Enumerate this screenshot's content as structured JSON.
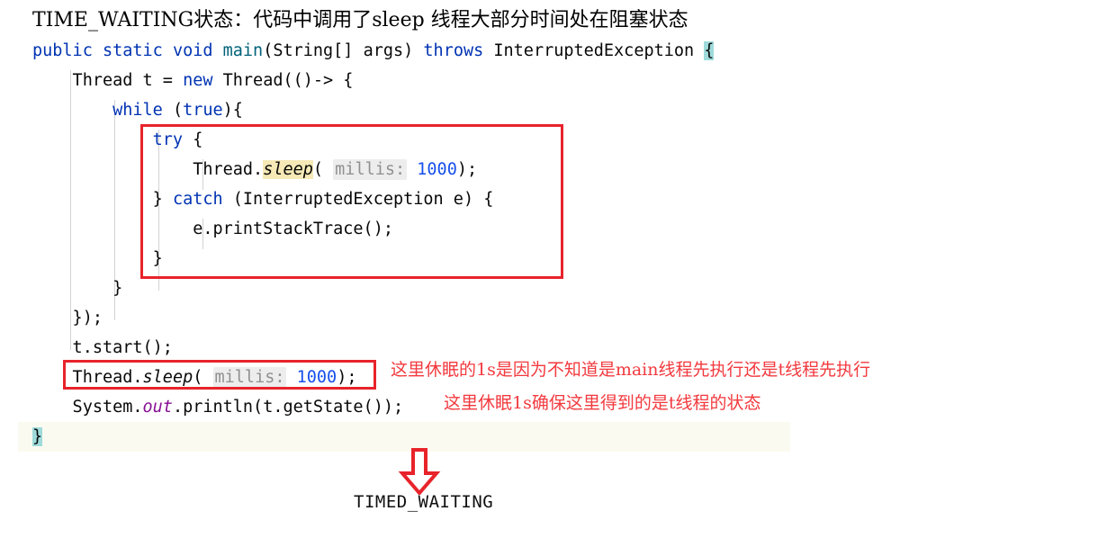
{
  "title": "TIME_WAITING状态：代码中调用了sleep 线程大部分时间处在阻塞状态",
  "editor": {
    "lines": [
      {
        "id": "line-1",
        "segments": [
          {
            "text": "public ",
            "style": "kw"
          },
          {
            "text": "static ",
            "style": "kw"
          },
          {
            "text": "void ",
            "style": "kw"
          },
          {
            "text": "main",
            "style": "meth"
          },
          {
            "text": "(String[] args) ",
            "style": "plain"
          },
          {
            "text": "throws ",
            "style": "kw"
          },
          {
            "text": "InterruptedException ",
            "style": "plain"
          },
          {
            "text": "{",
            "style": "brace-match"
          }
        ]
      },
      {
        "id": "line-2",
        "segments": [
          {
            "text": "    Thread t = ",
            "style": "plain"
          },
          {
            "text": "new ",
            "style": "kw"
          },
          {
            "text": "Thread(()-> {",
            "style": "plain"
          }
        ]
      },
      {
        "id": "line-3",
        "segments": [
          {
            "text": "        ",
            "style": "plain"
          },
          {
            "text": "while ",
            "style": "kw"
          },
          {
            "text": "(",
            "style": "plain"
          },
          {
            "text": "true",
            "style": "kw"
          },
          {
            "text": "){",
            "style": "plain"
          }
        ]
      },
      {
        "id": "line-4",
        "segments": [
          {
            "text": "            ",
            "style": "plain"
          },
          {
            "text": "try ",
            "style": "kw"
          },
          {
            "text": "{",
            "style": "plain"
          }
        ]
      },
      {
        "id": "line-5",
        "segments": [
          {
            "text": "                Thread.",
            "style": "plain"
          },
          {
            "text": "sleep",
            "style": "hl-y"
          },
          {
            "text": "( ",
            "style": "plain"
          },
          {
            "text": "millis:",
            "style": "param"
          },
          {
            "text": " ",
            "style": "plain"
          },
          {
            "text": "1000",
            "style": "num"
          },
          {
            "text": ");",
            "style": "plain"
          }
        ]
      },
      {
        "id": "line-6",
        "segments": [
          {
            "text": "            } ",
            "style": "plain"
          },
          {
            "text": "catch ",
            "style": "kw"
          },
          {
            "text": "(InterruptedException e) {",
            "style": "plain"
          }
        ]
      },
      {
        "id": "line-7",
        "segments": [
          {
            "text": "                e.printStackTrace();",
            "style": "plain"
          }
        ]
      },
      {
        "id": "line-8",
        "segments": [
          {
            "text": "            }",
            "style": "plain"
          }
        ]
      },
      {
        "id": "line-9",
        "segments": [
          {
            "text": "        }",
            "style": "plain"
          }
        ]
      },
      {
        "id": "line-10",
        "segments": [
          {
            "text": "    });",
            "style": "plain"
          }
        ]
      },
      {
        "id": "line-11",
        "segments": [
          {
            "text": "    t.start();",
            "style": "plain"
          }
        ]
      },
      {
        "id": "line-12",
        "segments": [
          {
            "text": "    Thread.",
            "style": "plain"
          },
          {
            "text": "sleep",
            "style": "ital"
          },
          {
            "text": "( ",
            "style": "plain"
          },
          {
            "text": "millis:",
            "style": "param"
          },
          {
            "text": " ",
            "style": "plain"
          },
          {
            "text": "1000",
            "style": "num"
          },
          {
            "text": ");",
            "style": "plain"
          }
        ]
      },
      {
        "id": "line-13",
        "segments": [
          {
            "text": "    System.",
            "style": "plain"
          },
          {
            "text": "out",
            "style": "stat"
          },
          {
            "text": ".println(t.getState());",
            "style": "plain"
          }
        ]
      },
      {
        "id": "line-14",
        "current": true,
        "segments": [
          {
            "text": "}",
            "style": "brace-match"
          }
        ]
      }
    ]
  },
  "annotations": {
    "note_1": "这里休眠的1s是因为不知道是main线程先执行还是t线程先执行",
    "note_2": "这里休眠1s确保这里得到的是t线程的状态"
  },
  "output": {
    "label": "TIMED_WAITING"
  },
  "colors": {
    "keyword": "#0033b3",
    "method": "#00627a",
    "number": "#1750eb",
    "static_field": "#871094",
    "annotation_red": "#f23a3f",
    "box_red": "#e8232a",
    "brace_highlight": "#9fdbdb",
    "current_line": "#fbfaf0",
    "search_highlight": "#f6e9b6"
  }
}
